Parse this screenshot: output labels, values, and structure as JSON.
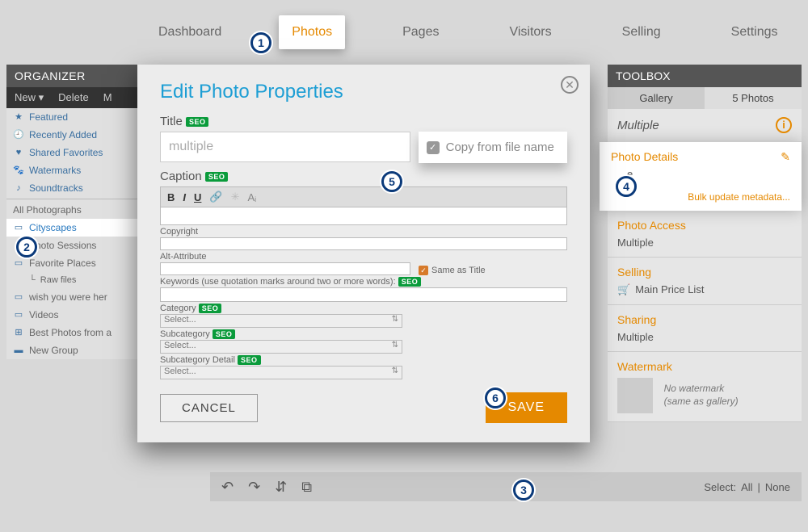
{
  "nav": {
    "items": [
      "Dashboard",
      "Photos",
      "Pages",
      "Visitors",
      "Selling",
      "Settings"
    ],
    "active": "Photos"
  },
  "organizer": {
    "header": "ORGANIZER",
    "toolbar": {
      "new": "New ▾",
      "delete": "Delete",
      "more": "M"
    },
    "pinned": [
      {
        "icon": "★",
        "label": "Featured"
      },
      {
        "icon": "🕘",
        "label": "Recently Added"
      },
      {
        "icon": "♥",
        "label": "Shared Favorites"
      },
      {
        "icon": "🐾",
        "label": "Watermarks"
      },
      {
        "icon": "♪",
        "label": "Soundtracks"
      }
    ],
    "all": "All Photographs",
    "galleries": [
      {
        "label": "Cityscapes",
        "selected": true
      },
      {
        "label": "Photo Sessions"
      },
      {
        "label": "Favorite Places"
      },
      {
        "label": "Raw files",
        "indent": true
      },
      {
        "label": "wish you were her"
      },
      {
        "label": "Videos"
      },
      {
        "label": "Best Photos from a"
      },
      {
        "label": "New Group",
        "folder": true
      }
    ]
  },
  "toolbox": {
    "header": "TOOLBOX",
    "tabs": {
      "gallery": "Gallery",
      "count": "5 Photos"
    },
    "title": "Multiple",
    "photo_details": {
      "header": "Photo Details",
      "sub": "e",
      "bulk": "Bulk update metadata..."
    },
    "access": {
      "header": "Photo Access",
      "value": "Multiple"
    },
    "selling": {
      "header": "Selling",
      "value": "Main Price List"
    },
    "sharing": {
      "header": "Sharing",
      "value": "Multiple"
    },
    "watermark": {
      "header": "Watermark",
      "line1": "No watermark",
      "line2": "(same as gallery)"
    }
  },
  "bottombar": {
    "select_label": "Select:",
    "all": "All",
    "sep": "|",
    "none": "None"
  },
  "modal": {
    "heading": "Edit Photo Properties",
    "title_label": "Title",
    "title_value": "multiple",
    "copy_label": "Copy from file name",
    "caption_label": "Caption",
    "copyright_label": "Copyright",
    "alt_label": "Alt-Attribute",
    "same_as_title": "Same as Title",
    "keywords_label": "Keywords (use quotation marks around two or more words):",
    "category_label": "Category",
    "subcategory_label": "Subcategory",
    "subcat_detail_label": "Subcategory Detail",
    "select_placeholder": "Select...",
    "cancel": "CANCEL",
    "save": "SAVE",
    "seo": "SEO"
  },
  "annotations": {
    "1": "1",
    "2": "2",
    "3": "3",
    "4": "4",
    "5": "5",
    "6": "6"
  }
}
